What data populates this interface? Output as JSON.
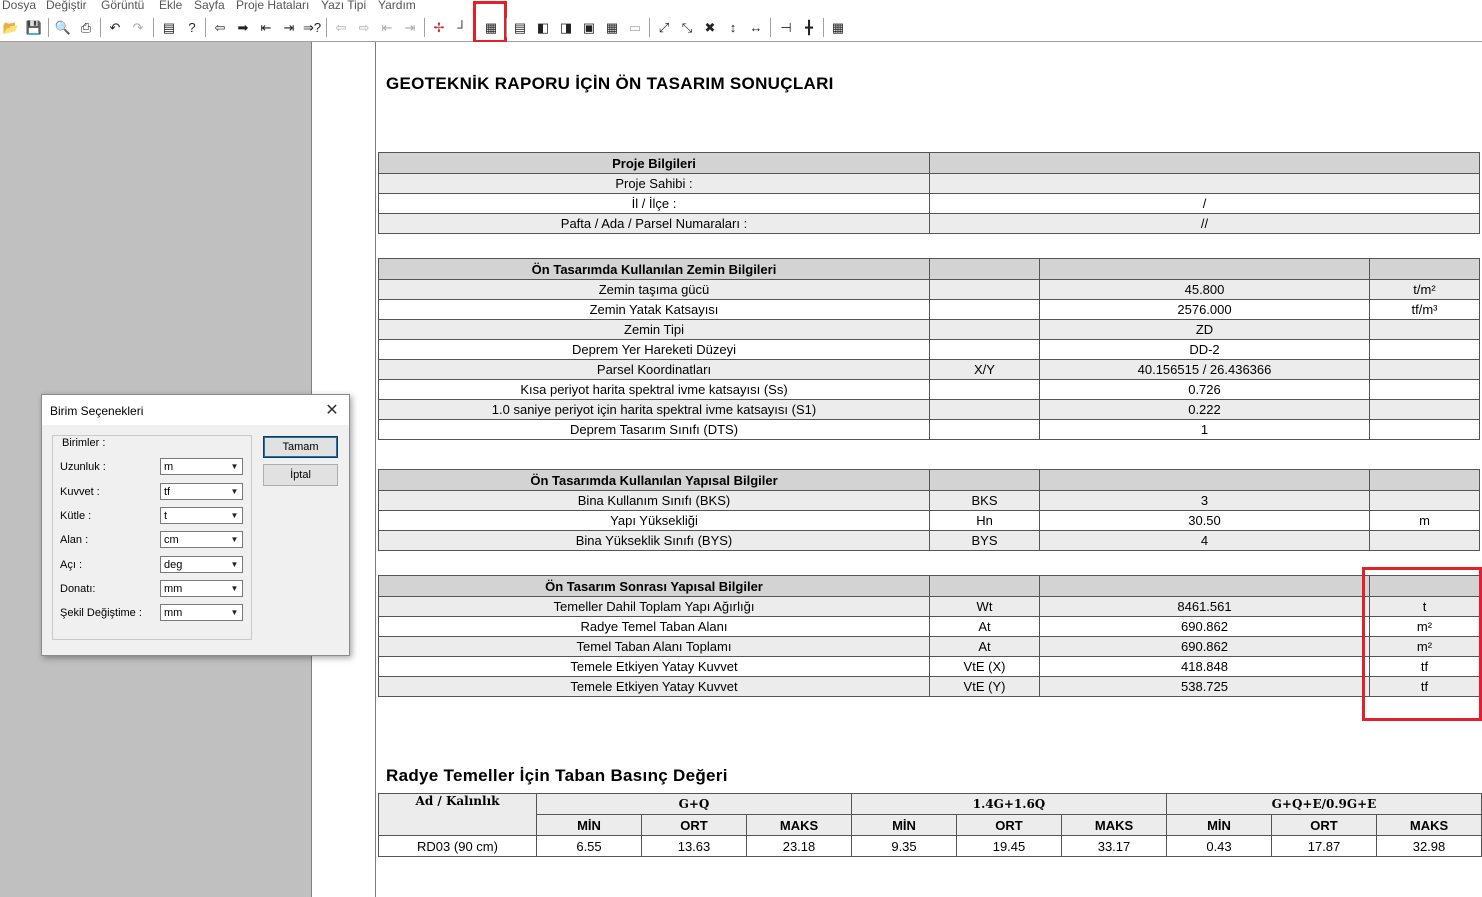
{
  "menu": [
    "Dosya",
    "Değiştir",
    "Görüntü",
    "Ekle",
    "Sayfa",
    "Proje Hataları",
    "Yazı Tipi",
    "Yardım"
  ],
  "toolbar_icons": [
    "open-icon",
    "save-icon",
    "print-preview-icon",
    "print-icon",
    "undo-icon",
    "redo-icon",
    "page-setup-icon",
    "help-icon",
    "arrow-left-icon",
    "arrow-right-icon",
    "go-first-icon",
    "go-last-icon",
    "go-to-icon",
    "arrow-left-disabled-icon",
    "arrow-right-disabled-icon",
    "first-disabled-icon",
    "last-disabled-icon",
    "insert-icon",
    "line-icon",
    "units-icon",
    "header-icon",
    "column-left-icon",
    "column-right-icon",
    "page-icon",
    "table-icon",
    "format-icon",
    "zoom-fit-icon",
    "zoom-in-icon",
    "zoom-out-icon",
    "height-icon",
    "width-icon",
    "merge-icon",
    "split-icon",
    "grid-icon"
  ],
  "report": {
    "title": "GEOTEKNİK RAPORU İÇİN ÖN TASARIM SONUÇLARI",
    "proje": {
      "header": "Proje Bilgileri",
      "rows": [
        {
          "label": "Proje Sahibi :",
          "value": ""
        },
        {
          "label": "İl / İlçe :",
          "value": "/"
        },
        {
          "label": "Pafta / Ada / Parsel Numaraları :",
          "value": "//"
        }
      ]
    },
    "zemin": {
      "header": "Ön Tasarımda Kullanılan Zemin Bilgileri",
      "rows": [
        {
          "label": "Zemin taşıma gücü",
          "sym": "",
          "value": "45.800",
          "unit": "t/m²"
        },
        {
          "label": "Zemin Yatak Katsayısı",
          "sym": "",
          "value": "2576.000",
          "unit": "tf/m³"
        },
        {
          "label": "Zemin Tipi",
          "sym": "",
          "value": "ZD",
          "unit": ""
        },
        {
          "label": "Deprem Yer Hareketi Düzeyi",
          "sym": "",
          "value": "DD-2",
          "unit": ""
        },
        {
          "label": "Parsel Koordinatları",
          "sym": "X/Y",
          "value": "40.156515 / 26.436366",
          "unit": ""
        },
        {
          "label": "Kısa periyot harita spektral ivme katsayısı (Ss)",
          "sym": "",
          "value": "0.726",
          "unit": ""
        },
        {
          "label": "1.0 saniye periyot için harita spektral ivme katsayısı (S1)",
          "sym": "",
          "value": "0.222",
          "unit": ""
        },
        {
          "label": "Deprem Tasarım Sınıfı (DTS)",
          "sym": "",
          "value": "1",
          "unit": ""
        }
      ]
    },
    "yapisal": {
      "header": "Ön Tasarımda Kullanılan Yapısal Bilgiler",
      "rows": [
        {
          "label": "Bina Kullanım Sınıfı (BKS)",
          "sym": "BKS",
          "value": "3",
          "unit": ""
        },
        {
          "label": "Yapı Yüksekliği",
          "sym": "Hn",
          "value": "30.50",
          "unit": "m"
        },
        {
          "label": "Bina Yükseklik Sınıfı (BYS)",
          "sym": "BYS",
          "value": "4",
          "unit": ""
        }
      ]
    },
    "sonrasi": {
      "header": "Ön Tasarım Sonrası Yapısal Bilgiler",
      "rows": [
        {
          "label": "Temeller Dahil Toplam Yapı Ağırlığı",
          "sym": "Wt",
          "value": "8461.561",
          "unit": "t"
        },
        {
          "label": "Radye Temel Taban Alanı",
          "sym": "At",
          "value": "690.862",
          "unit": "m²"
        },
        {
          "label": "Temel Taban Alanı Toplamı",
          "sym": "At",
          "value": "690.862",
          "unit": "m²"
        },
        {
          "label": "Temele Etkiyen Yatay Kuvvet",
          "sym": "VtE (X)",
          "value": "418.848",
          "unit": "tf"
        },
        {
          "label": "Temele Etkiyen Yatay Kuvvet",
          "sym": "VtE (Y)",
          "value": "538.725",
          "unit": "tf"
        }
      ]
    },
    "basinc": {
      "title": "Radye Temeller İçin Taban Basınç Değeri",
      "col0": "Ad / Kalınlık",
      "groups": [
        "G+Q",
        "1.4G+1.6Q",
        "G+Q+E/0.9G+E"
      ],
      "subs": [
        "MİN",
        "ORT",
        "MAKS"
      ],
      "rows": [
        {
          "name": "RD03 (90 cm)",
          "values": [
            "6.55",
            "13.63",
            "23.18",
            "9.35",
            "19.45",
            "33.17",
            "0.43",
            "17.87",
            "32.98"
          ]
        }
      ]
    }
  },
  "dialog": {
    "title": "Birim Seçenekleri",
    "group": "Birimler :",
    "fields": [
      {
        "label": "Uzunluk :",
        "value": "m"
      },
      {
        "label": "Kuvvet :",
        "value": "tf"
      },
      {
        "label": "Kütle :",
        "value": "t"
      },
      {
        "label": "Alan :",
        "value": "cm"
      },
      {
        "label": "Açı :",
        "value": "deg"
      },
      {
        "label": "Donatı:",
        "value": "mm"
      },
      {
        "label": "Şekil Değiştime :",
        "value": "mm"
      }
    ],
    "ok": "Tamam",
    "cancel": "İptal"
  }
}
